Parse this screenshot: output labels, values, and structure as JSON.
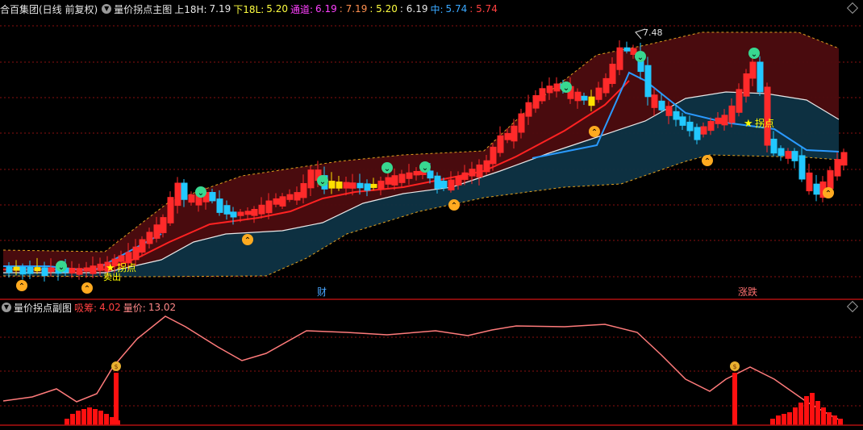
{
  "main_header": {
    "stock": "合百集团(日线 前复权)",
    "indicator": "量价拐点主图",
    "upper_label": "上18H:",
    "upper_value": "7.19",
    "lower_label": "下18L:",
    "lower_value": "5.20",
    "channel_label": "通道:",
    "channel_values": [
      "6.19",
      ": 7.19",
      ": 5.20",
      ": 6.19"
    ],
    "mid_label": "中:",
    "mid_value": "5.74",
    "mid_value2": ": 5.74"
  },
  "sub_header": {
    "indicator": "量价拐点副图",
    "absorb_label": "吸筹:",
    "absorb_value": "4.02",
    "price_label": "量价:",
    "price_value": "13.02"
  },
  "markers": {
    "top_price": "7.48",
    "turn_point": "拐点",
    "sell_label": "卖出",
    "finance_tag": "财",
    "limit_tag": "涨跌"
  },
  "colors": {
    "up": "#ff2a2a",
    "down": "#22c8ff",
    "doji": "#ffe000",
    "upper_band_fill": "#4d0c0f",
    "lower_band_fill": "#0e3345",
    "mid_line": "#ff2222",
    "white_line": "#e8e8e8",
    "blue_line": "#2a9aff",
    "grid": "#8a1010",
    "volume_curve": "#ff7b7b",
    "volume_bar": "#ff1010"
  },
  "chart_data": [
    {
      "type": "candlestick",
      "title": "量价拐点主图",
      "ylim": [
        4.6,
        7.6
      ],
      "series": [
        {
          "name": "上18H",
          "value": 7.19
        },
        {
          "name": "下18L",
          "value": 5.2
        },
        {
          "name": "中",
          "value": 5.74
        }
      ],
      "annotations": [
        "7.48",
        "拐点",
        "卖出"
      ]
    },
    {
      "type": "bar",
      "title": "量价拐点副图",
      "series": [
        {
          "name": "吸筹",
          "value": 4.02
        },
        {
          "name": "量价",
          "value": 13.02
        }
      ]
    }
  ]
}
